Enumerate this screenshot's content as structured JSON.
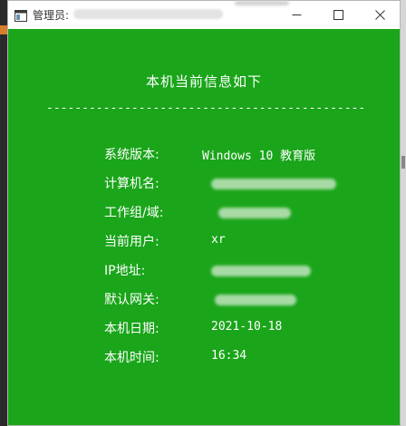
{
  "window": {
    "title": "管理员:",
    "controls": {
      "minimize_icon": "minimize-icon",
      "maximize_icon": "maximize-icon",
      "close_icon": "close-icon"
    }
  },
  "colors": {
    "background": "#1aa51a",
    "text": "#ffffff",
    "titlebar": "#ffffff"
  },
  "console": {
    "heading": "本机当前信息如下",
    "divider": "----------------------------------------------------",
    "rows": [
      {
        "label": "系统版本:",
        "value": "Windows 10 教育版"
      },
      {
        "label": "计算机名:",
        "value": ""
      },
      {
        "label": "工作组/域:",
        "value": ""
      },
      {
        "label": "当前用户:",
        "value": "xr"
      },
      {
        "label": "IP地址:",
        "value": ""
      },
      {
        "label": "默认网关:",
        "value": ""
      },
      {
        "label": "本机日期:",
        "value": "2021-10-18"
      },
      {
        "label": "本机时间:",
        "value": "16:34"
      }
    ]
  }
}
